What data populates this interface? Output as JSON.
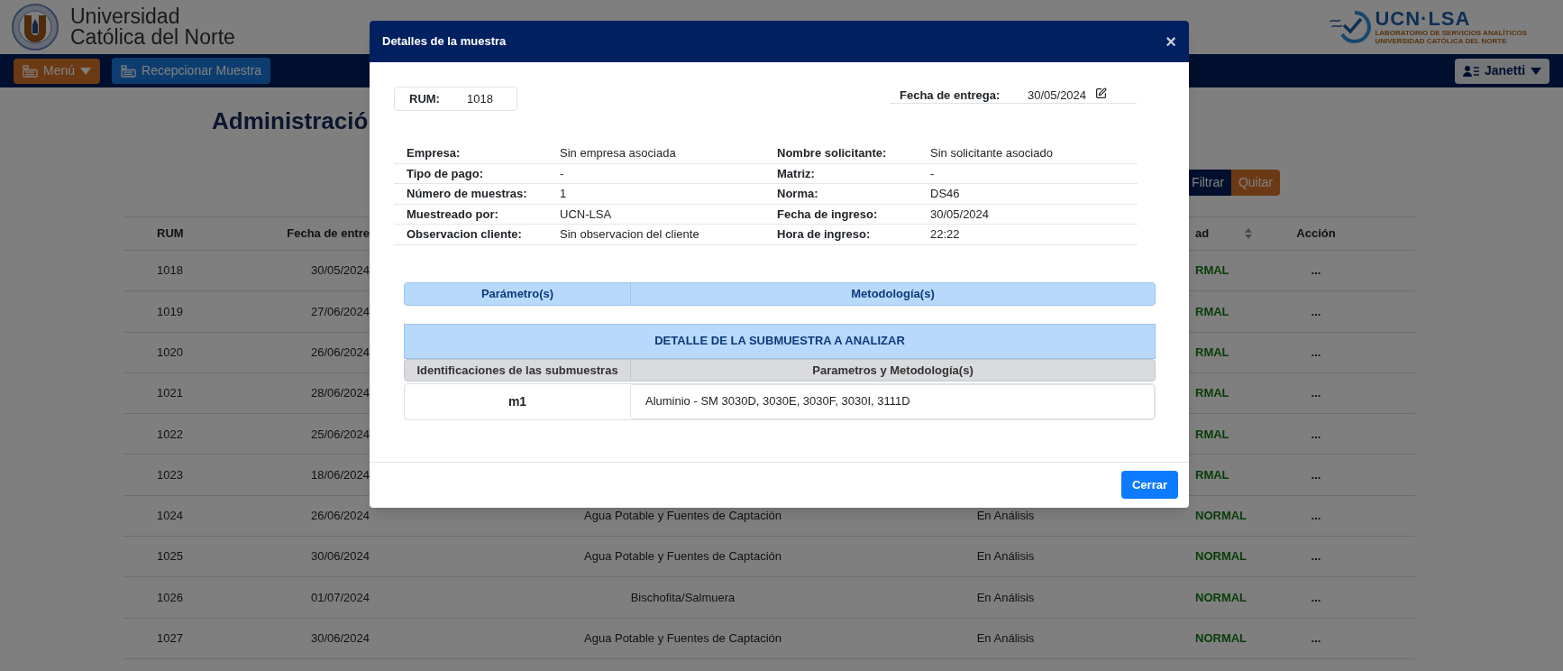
{
  "header": {
    "university_name": [
      "Universidad",
      "Católica del Norte"
    ],
    "lab_logo": {
      "name": "UCN·LSA",
      "subtitle": [
        "LABORATORIO DE SERVICIOS ANALÍTICOS",
        "UNIVERSIDAD CATÓLICA DEL NORTE"
      ]
    }
  },
  "navbar": {
    "menu_button": "Menú",
    "receive_button": "Recepcionar Muestra",
    "user_button": "Janetti"
  },
  "page": {
    "title": "Administració",
    "filter_buttons": [
      {
        "label": "Filtrar",
        "kind": "filter"
      },
      {
        "label": "Quitar",
        "kind": "clear"
      }
    ],
    "table": {
      "columns": {
        "rum": "RUM",
        "delivery_date": "Fecha de entre",
        "column_5": "ad",
        "action": "Acción"
      },
      "rows": [
        {
          "rum": "1018",
          "delivery_date": "30/05/2024",
          "priority": "RMAL",
          "action": "..."
        },
        {
          "rum": "1019",
          "delivery_date": "27/06/2024",
          "priority": "RMAL",
          "action": "..."
        },
        {
          "rum": "1020",
          "delivery_date": "26/06/2024",
          "priority": "RMAL",
          "action": "..."
        },
        {
          "rum": "1021",
          "delivery_date": "28/06/2024",
          "priority": "RMAL",
          "action": "..."
        },
        {
          "rum": "1022",
          "delivery_date": "25/06/2024",
          "priority": "RMAL",
          "action": "..."
        },
        {
          "rum": "1023",
          "delivery_date": "18/06/2024",
          "priority": "RMAL",
          "action": "..."
        },
        {
          "rum": "1024",
          "delivery_date": "26/06/2024",
          "matrix": "Agua Potable y Fuentes de Captación",
          "status": "En Análisis",
          "priority": "NORMAL",
          "action": "..."
        },
        {
          "rum": "1025",
          "delivery_date": "30/06/2024",
          "matrix": "Agua Potable y Fuentes de Captación",
          "status": "En Análisis",
          "priority": "NORMAL",
          "action": "..."
        },
        {
          "rum": "1026",
          "delivery_date": "01/07/2024",
          "matrix": "Bischofita/Salmuera",
          "status": "En Análisis",
          "priority": "NORMAL",
          "action": "..."
        },
        {
          "rum": "1027",
          "delivery_date": "30/06/2024",
          "matrix": "Agua Potable y Fuentes de Captación",
          "status": "En Análisis",
          "priority": "NORMAL",
          "action": "..."
        }
      ]
    }
  },
  "modal": {
    "title": "Detalles de la muestra",
    "close": "×",
    "rum": {
      "label": "RUM:",
      "value": "1018"
    },
    "delivery": {
      "label": "Fecha de entrega:",
      "value": "30/05/2024"
    },
    "info_rows": [
      [
        {
          "label": "Empresa:",
          "value": "Sin empresa asociada"
        },
        {
          "label": "Nombre solicitante:",
          "value": "Sin solicitante asociado"
        }
      ],
      [
        {
          "label": "Tipo de pago:",
          "value": "-"
        },
        {
          "label": "Matriz:",
          "value": "-"
        }
      ],
      [
        {
          "label": "Número de muestras:",
          "value": "1"
        },
        {
          "label": "Norma:",
          "value": "DS46"
        }
      ],
      [
        {
          "label": "Muestreado por:",
          "value": "UCN-LSA"
        },
        {
          "label": "Fecha de ingreso:",
          "value": "30/05/2024"
        }
      ],
      [
        {
          "label": "Observacion cliente:",
          "value": "Sin observacion del cliente"
        },
        {
          "label": "Hora de ingreso:",
          "value": "22:22"
        }
      ]
    ],
    "params_table": {
      "columns": [
        "Parámetro(s)",
        "Metodología(s)"
      ]
    },
    "submuestras": {
      "title": "DETALLE DE LA SUBMUESTRA A ANALIZAR",
      "columns": [
        "Identificaciones de las submuestras",
        "Parametros y Metodología(s)"
      ],
      "rows": [
        {
          "id": "m1",
          "detail": "Aluminio - SM 3030D, 3030E, 3030F, 3030I, 3111D"
        }
      ]
    },
    "footer_button": "Cerrar"
  }
}
